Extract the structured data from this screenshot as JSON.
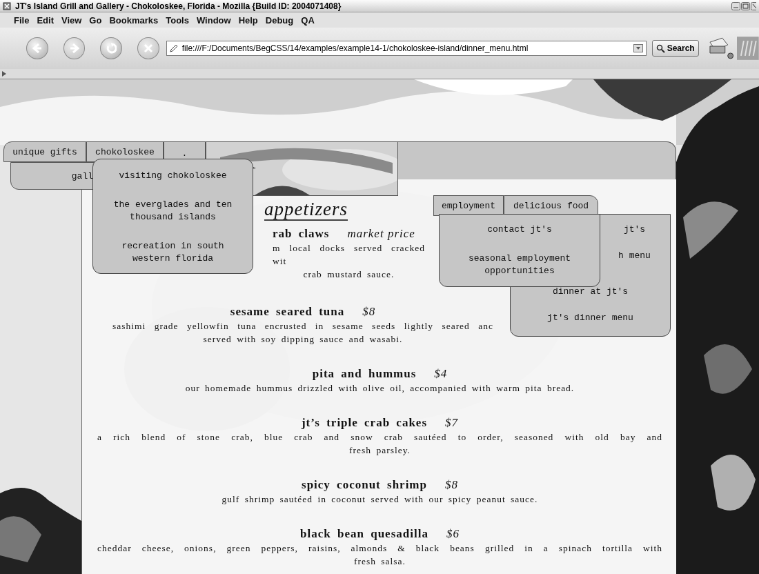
{
  "window": {
    "title": "JT's Island Grill and Gallery - Chokoloskee, Florida - Mozilla {Build ID: 2004071408}"
  },
  "menu_bar": [
    "File",
    "Edit",
    "View",
    "Go",
    "Bookmarks",
    "Tools",
    "Window",
    "Help",
    "Debug",
    "QA"
  ],
  "toolbar": {
    "url": "file:///F:/Documents/BegCSS/14/examples/example14-1/chokoloskee-island/dinner_menu.html",
    "search_button": "Search"
  },
  "site": {
    "nav_tabs": [
      "unique gifts",
      "chokoloskee",
      "."
    ],
    "nav_second_row": "gall",
    "chokoloskee_menu": [
      "visiting chokoloskee",
      "the everglades and ten thousand islands",
      "recreation in south western florida"
    ],
    "right_tabs": [
      "employment",
      "delicious food"
    ],
    "food_menu": [
      "jt's",
      "h menu",
      "dinner at jt's",
      "jt's dinner menu"
    ],
    "employment_menu": [
      "contact jt's",
      "seasonal employment opportunities"
    ],
    "menu_heading": "appetizers",
    "items": [
      {
        "name": "rab claws",
        "price": "market price",
        "lines": [
          "m local docks served cracked wit",
          "crab mustard sauce."
        ]
      },
      {
        "name": "sesame seared tuna",
        "price": "$8",
        "lines": [
          "sashimi grade yellowfin tuna encrusted in sesame seeds lightly seared anc",
          "served with soy dipping sauce and wasabi."
        ]
      },
      {
        "name": "pita and hummus",
        "price": "$4",
        "lines": [
          "our homemade hummus drizzled with olive oil, accompanied with warm pita bread."
        ]
      },
      {
        "name": "jt’s triple crab cakes",
        "price": "$7",
        "lines": [
          "a rich blend of stone crab, blue crab and snow crab sautéed to order, seasoned with old bay and",
          "fresh parsley."
        ]
      },
      {
        "name": "spicy coconut shrimp",
        "price": "$8",
        "lines": [
          "gulf shrimp sautéed in coconut served with our spicy peanut sauce."
        ]
      },
      {
        "name": "black bean quesadilla",
        "price": "$6",
        "lines": [
          "cheddar cheese, onions, green peppers, raisins, almonds & black beans grilled in a spinach tortilla with",
          "fresh salsa."
        ]
      }
    ]
  }
}
